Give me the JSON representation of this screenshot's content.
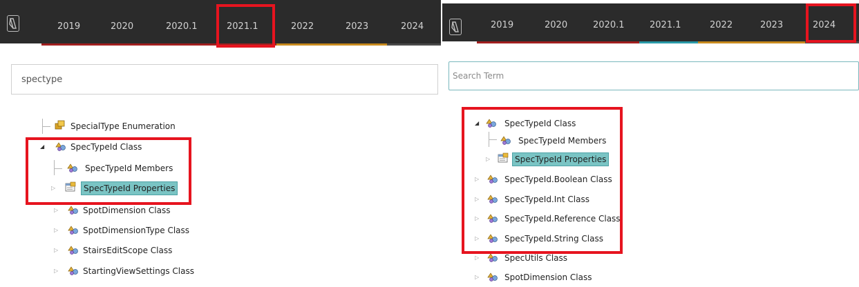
{
  "left": {
    "tabs": [
      "2019",
      "2020",
      "2020.1",
      "2021.1",
      "2022",
      "2023",
      "2024"
    ],
    "stripe_colors": [
      "#a11f1f",
      "#a11f1f",
      "#a11f1f",
      "#a11f1f",
      "#c88a1e",
      "#c88a1e",
      "#4a4a4a"
    ],
    "search": {
      "value": "spectype"
    },
    "tree": [
      {
        "label": "SpecialType Enumeration",
        "icon": "enum-icon"
      },
      {
        "label": "SpecTypeId Class",
        "icon": "class-icon",
        "expanded": true
      },
      {
        "label": "SpecTypeId Members",
        "icon": "class-icon"
      },
      {
        "label": "SpecTypeId Properties",
        "icon": "properties-icon",
        "selected": true
      },
      {
        "label": "SpotDimension Class",
        "icon": "class-icon"
      },
      {
        "label": "SpotDimensionType Class",
        "icon": "class-icon"
      },
      {
        "label": "StairsEditScope Class",
        "icon": "class-icon"
      },
      {
        "label": "StartingViewSettings Class",
        "icon": "class-icon"
      }
    ]
  },
  "right": {
    "tabs": [
      "2019",
      "2020",
      "2020.1",
      "2021.1",
      "2022",
      "2023",
      "2024"
    ],
    "stripe_colors": [
      "#a11f1f",
      "#a11f1f",
      "#a11f1f",
      "#2a9aa8",
      "#c88a1e",
      "#c88a1e",
      "#4a4a4a"
    ],
    "search": {
      "value": "",
      "placeholder": "Search Term"
    },
    "tree": [
      {
        "label": "SpecTypeId Class",
        "icon": "class-icon",
        "expanded": true
      },
      {
        "label": "SpecTypeId Members",
        "icon": "class-icon"
      },
      {
        "label": "SpecTypeId Properties",
        "icon": "properties-icon",
        "selected": true
      },
      {
        "label": "SpecTypeId.Boolean Class",
        "icon": "class-icon"
      },
      {
        "label": "SpecTypeId.Int Class",
        "icon": "class-icon"
      },
      {
        "label": "SpecTypeId.Reference Class",
        "icon": "class-icon"
      },
      {
        "label": "SpecTypeId.String Class",
        "icon": "class-icon"
      },
      {
        "label": "SpecUtils Class",
        "icon": "class-icon"
      },
      {
        "label": "SpotDimension Class",
        "icon": "class-icon"
      }
    ]
  },
  "highlight_color": "#e6141f",
  "selected_color": "#7ac4c4"
}
